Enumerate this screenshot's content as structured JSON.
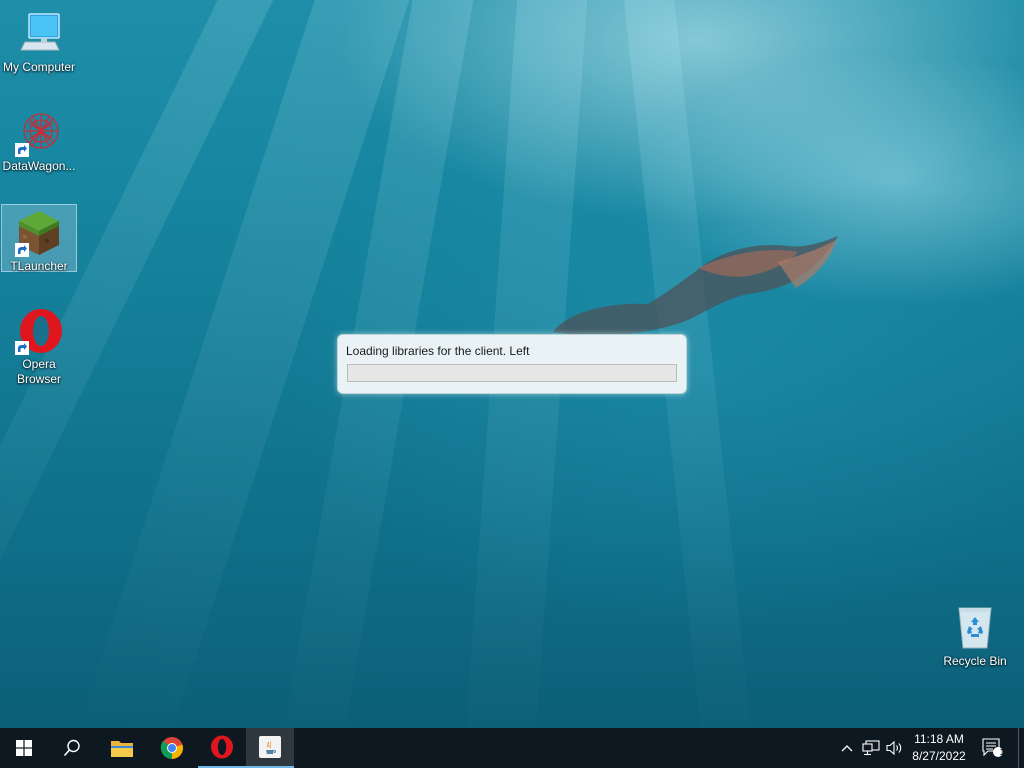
{
  "desktop": {
    "icons": [
      {
        "label": "My Computer",
        "icon": "computer-icon"
      },
      {
        "label": "DataWagon...",
        "icon": "datawagon-icon"
      },
      {
        "label": "TLauncher",
        "icon": "tlauncher-icon"
      },
      {
        "label": "Opera\nBrowser",
        "icon": "opera-icon"
      },
      {
        "label": "Recycle Bin",
        "icon": "recycle-bin-icon"
      }
    ]
  },
  "loader": {
    "message": "Loading libraries for the client. Left",
    "progress": 0
  },
  "taskbar": {
    "items": [
      {
        "name": "start",
        "icon": "windows-logo-icon"
      },
      {
        "name": "search",
        "icon": "search-icon"
      },
      {
        "name": "file-explorer",
        "icon": "folder-icon"
      },
      {
        "name": "chrome",
        "icon": "chrome-icon"
      },
      {
        "name": "opera",
        "icon": "opera-icon"
      },
      {
        "name": "java",
        "icon": "java-icon"
      }
    ],
    "tray": {
      "time": "11:18 AM",
      "date": "8/27/2022",
      "notification_count": "1"
    }
  },
  "colors": {
    "taskbar": "#0d1820",
    "accent": "#6fb8e8",
    "opera_red": "#e0161f"
  }
}
